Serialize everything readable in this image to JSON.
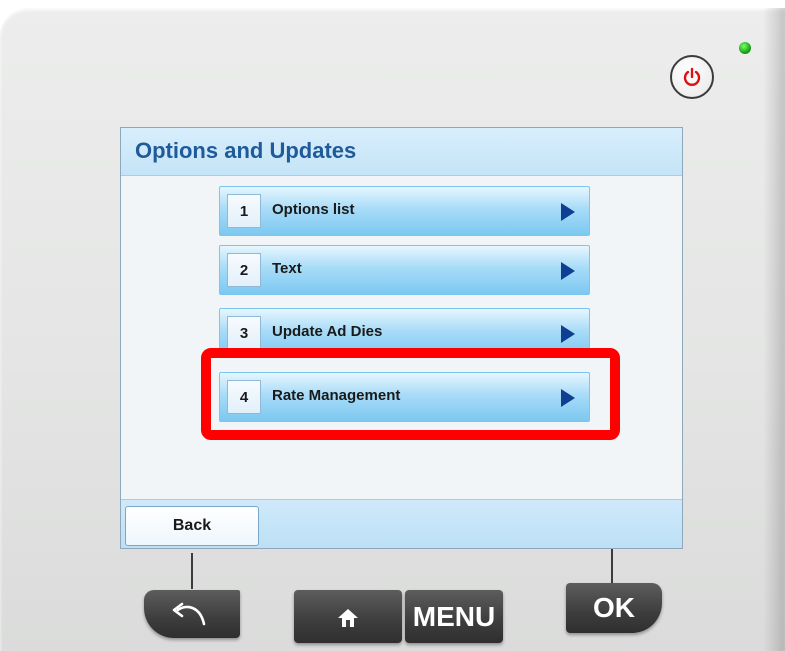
{
  "screen": {
    "title": "Options and Updates",
    "menu_items": [
      {
        "number": "1",
        "label": "Options list"
      },
      {
        "number": "2",
        "label": "Text"
      },
      {
        "number": "3",
        "label": "Update Ad Dies"
      },
      {
        "number": "4",
        "label": "Rate Management"
      }
    ],
    "highlighted_item": "4",
    "back_label": "Back"
  },
  "hardware_buttons": {
    "back_icon": "undo-arrow-icon",
    "home_icon": "home-icon",
    "menu_label": "MENU",
    "ok_label": "OK"
  },
  "indicators": {
    "power_icon": "power-icon",
    "led_color": "#1fae1c",
    "highlight_color": "#ff0000"
  }
}
